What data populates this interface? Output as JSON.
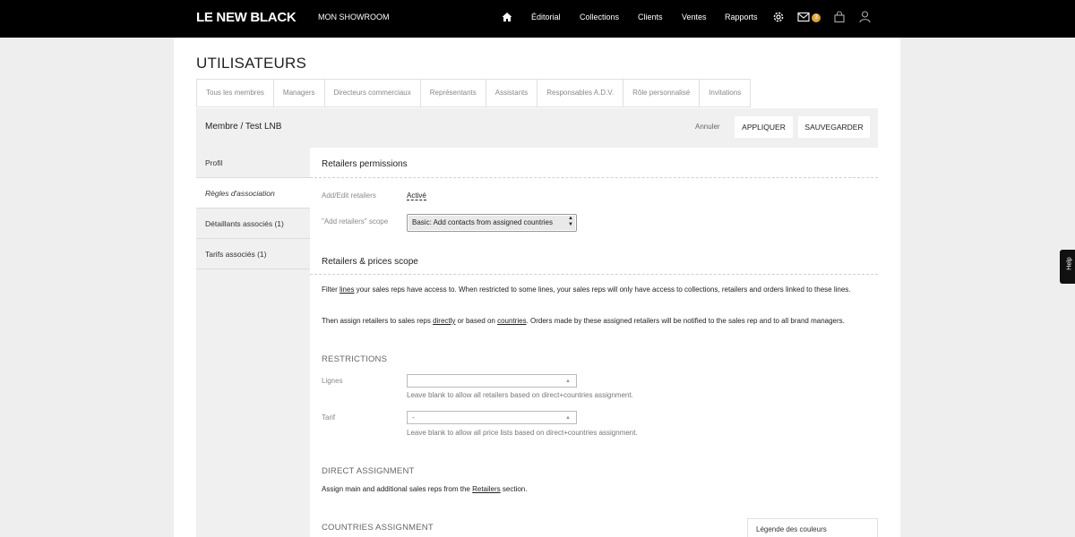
{
  "header": {
    "logo": "LE NEW BLACK",
    "showroom": "MON SHOWROOM",
    "nav": [
      "Éditorial",
      "Collections",
      "Clients",
      "Ventes",
      "Rapports"
    ],
    "mail_count": "3"
  },
  "page": {
    "title": "UTILISATEURS"
  },
  "tabs": [
    "Tous les membres",
    "Managers",
    "Directeurs commerciaux",
    "Représentants",
    "Assistants",
    "Responsables A.D.V.",
    "Rôle personnalisé",
    "Invitations"
  ],
  "member_bar": {
    "title": "Membre / Test LNB",
    "cancel": "Annuler",
    "apply": "APPLIQUER",
    "save": "SAUVEGARDER"
  },
  "sidebar": {
    "items": [
      "Profil",
      "Règles d'association",
      "Détaillants associés (1)",
      "Tarifs associés (1)"
    ]
  },
  "retailers_permissions": {
    "title": "Retailers permissions",
    "add_edit_label": "Add/Edit retailers",
    "add_edit_value": "Activé",
    "scope_label": "\"Add retailers\" scope",
    "scope_value": "Basic: Add contacts from assigned countries"
  },
  "prices_scope": {
    "title": "Retailers & prices scope",
    "p1_a": "Filter ",
    "p1_link": "lines",
    "p1_b": " your sales reps have access to. When restricted to some lines, your sales reps will only have access to collections, retailers and orders linked to these lines.",
    "p2_a": "Then assign retailers to sales reps ",
    "p2_link1": "directly",
    "p2_b": " or based on ",
    "p2_link2": "countries",
    "p2_c": ". Orders made by these assigned retailers will be notified to the sales rep and to all brand managers."
  },
  "restrictions": {
    "title": "RESTRICTIONS",
    "lignes_label": "Lignes",
    "lignes_value": "",
    "lignes_hint": "Leave blank to allow all retailers based on direct+countries assignment.",
    "tarif_label": "Tarif",
    "tarif_value": "-",
    "tarif_hint": "Leave blank to allow all price lists based on direct+countries assignment."
  },
  "direct_assignment": {
    "title": "DIRECT ASSIGNMENT",
    "text_a": "Assign main and additional sales reps from the ",
    "text_link": "Retailers",
    "text_b": " section."
  },
  "countries_assignment": {
    "title": "COUNTRIES ASSIGNMENT",
    "legend": "Légende des couleurs"
  },
  "help": "Help"
}
